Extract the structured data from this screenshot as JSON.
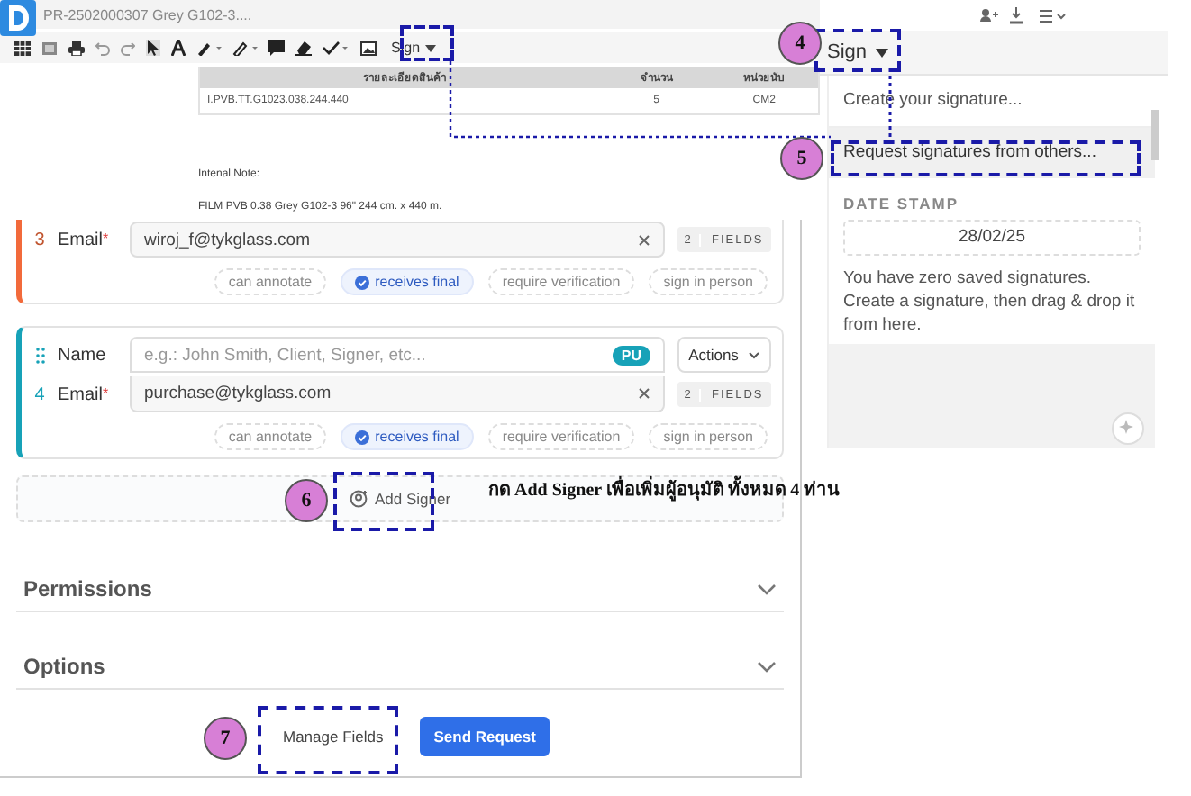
{
  "app_header": {
    "title": "PR-2502000307 Grey G102-3...."
  },
  "toolbar": {
    "sign_label": "Sign"
  },
  "document": {
    "columns": [
      "รายละเอียดสินค้า",
      "จำนวน",
      "หน่วยนับ"
    ],
    "rows": [
      [
        "I.PVB.TT.G1023.038.244.440",
        "5",
        "CM2"
      ]
    ],
    "note_label": "Intenal Note:",
    "note_text": "FILM PVB 0.38 Grey G102-3 96\" 244 cm. x 440 m."
  },
  "sign_menu": {
    "label": "Sign",
    "items": [
      {
        "label": "Create your signature...",
        "selected": false
      },
      {
        "label": "Request signatures from others...",
        "selected": true
      }
    ],
    "date_heading": "DATE STAMP",
    "date_value": "28/02/25",
    "message": "You have zero saved signatures. Create a signature, then drag & drop it from here."
  },
  "signers": [
    {
      "number": "3",
      "color": "#f26a3b",
      "email_label": "Email",
      "required_mark": "*",
      "email": "wiroj_f@tykglass.com",
      "fields_count": "2",
      "fields_label": "FIELDS",
      "options": [
        {
          "label": "can annotate",
          "checked": false
        },
        {
          "label": "receives final",
          "checked": true
        },
        {
          "label": "require verification",
          "checked": false
        },
        {
          "label": "sign in person",
          "checked": false
        }
      ]
    },
    {
      "number": "4",
      "color": "#17a2b8",
      "name_label": "Name",
      "name_placeholder": "e.g.: John Smith, Client, Signer, etc...",
      "badge": "PU",
      "actions": "Actions",
      "email_label": "Email",
      "required_mark": "*",
      "email": "purchase@tykglass.com",
      "fields_count": "2",
      "fields_label": "FIELDS",
      "options": [
        {
          "label": "can annotate",
          "checked": false
        },
        {
          "label": "receives final",
          "checked": true
        },
        {
          "label": "require verification",
          "checked": false
        },
        {
          "label": "sign in person",
          "checked": false
        }
      ]
    }
  ],
  "add_signer": {
    "label": "Add Signer"
  },
  "instruction": "กด **Add Signer** เพื่อเพิ่มผู้อนุมัติ ทั้งหมด 4 ท่าน",
  "sections": [
    {
      "title": "Permissions",
      "expanded": false
    },
    {
      "title": "Options",
      "expanded": false
    }
  ],
  "footer_buttons": [
    {
      "label": "Manage Fields",
      "kind": "secondary"
    },
    {
      "label": "Send Request",
      "kind": "primary"
    }
  ],
  "callouts": [
    {
      "number": "4"
    },
    {
      "number": "5"
    },
    {
      "number": "6"
    },
    {
      "number": "7"
    }
  ]
}
